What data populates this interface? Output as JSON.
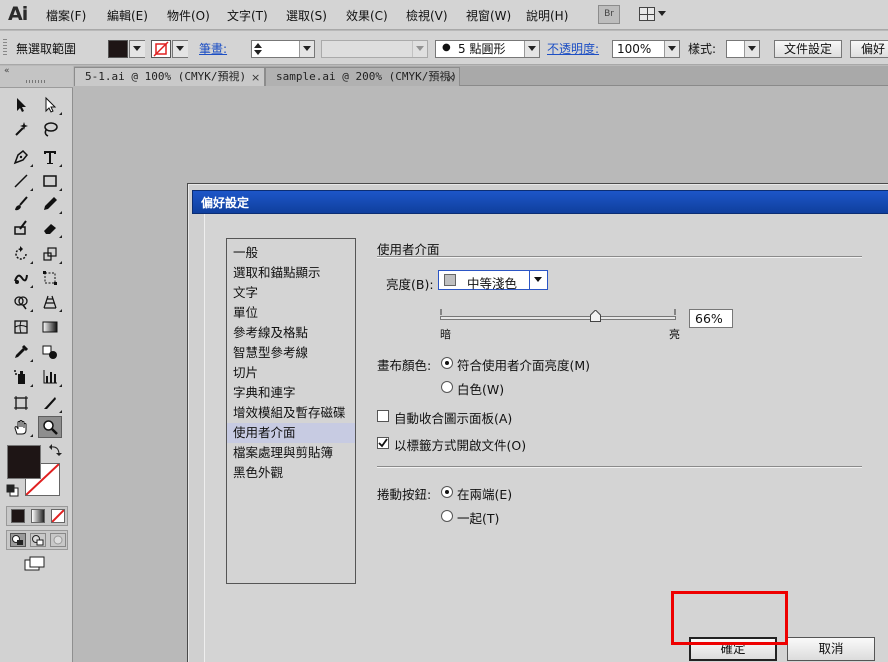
{
  "app": {
    "logo": "Ai",
    "bridge": "Br"
  },
  "menu": [
    {
      "id": "file",
      "label": "檔案(F)"
    },
    {
      "id": "edit",
      "label": "編輯(E)"
    },
    {
      "id": "object",
      "label": "物件(O)"
    },
    {
      "id": "type",
      "label": "文字(T)"
    },
    {
      "id": "select",
      "label": "選取(S)"
    },
    {
      "id": "effect",
      "label": "效果(C)"
    },
    {
      "id": "view",
      "label": "檢視(V)"
    },
    {
      "id": "window",
      "label": "視窗(W)"
    },
    {
      "id": "help",
      "label": "說明(H)"
    }
  ],
  "control": {
    "selection_status": "無選取範圍",
    "stroke_label": "筆畫:",
    "brush_label": "5 點圓形",
    "opacity_label": "不透明度:",
    "opacity_value": "100%",
    "style_label": "樣式:",
    "doc_setup": "文件設定",
    "prefs": "偏好",
    "fill_color": "#1e1515",
    "stroke_none_color": "#e02020"
  },
  "tabs": [
    {
      "label": "5-1.ai @ 100% (CMYK/預視)",
      "close": "×"
    },
    {
      "label": "sample.ai @ 200% (CMYK/預視)",
      "close": "×"
    }
  ],
  "dialog": {
    "title": "偏好設定",
    "categories": [
      "一般",
      "選取和錨點顯示",
      "文字",
      "單位",
      "參考線及格點",
      "智慧型參考線",
      "切片",
      "字典和連字",
      "增效模組及暫存磁碟",
      "使用者介面",
      "檔案處理與剪貼簿",
      "黑色外觀"
    ],
    "selected_category": "使用者介面",
    "section_title": "使用者介面",
    "brightness_label": "亮度(B):",
    "brightness_value": "中等淺色",
    "slider_dark": "暗",
    "slider_light": "亮",
    "slider_value": "66%",
    "slider_level": 0.66,
    "canvas_color_label": "畫布顏色:",
    "canvas_option_match": "符合使用者介面亮度(M)",
    "canvas_option_white": "白色(W)",
    "auto_collapse": "自動收合圖示面板(A)",
    "open_tabs": "以標籤方式開啟文件(O)",
    "scroll_label": "捲動按鈕:",
    "scroll_option_ends": "在兩端(E)",
    "scroll_option_together": "一起(T)",
    "ok": "確定",
    "cancel": "取消"
  }
}
